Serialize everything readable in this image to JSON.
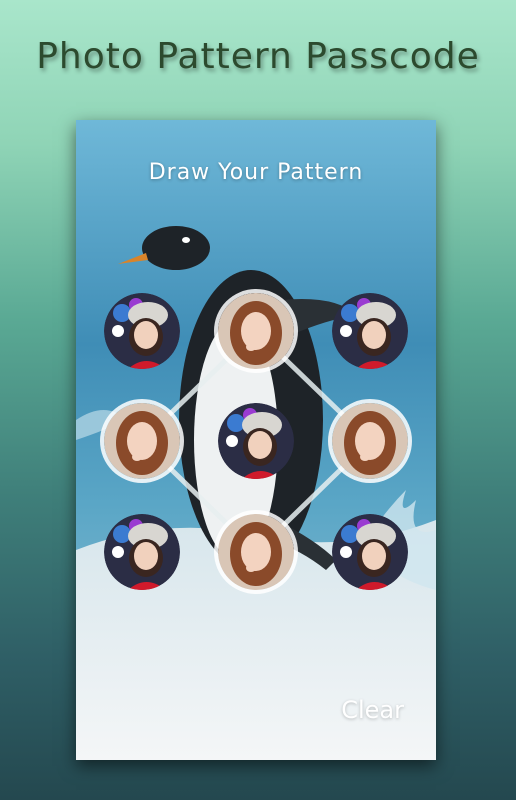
{
  "app": {
    "title": "Photo Pattern Passcode"
  },
  "lock_screen": {
    "prompt": "Draw Your Pattern",
    "clear_label": "Clear",
    "pattern_grid": {
      "rows": 3,
      "cols": 3,
      "selected_dots": [
        2,
        4,
        6,
        8
      ],
      "dots": [
        {
          "index": 1,
          "photo": "girl-with-knit-hat",
          "selected": false
        },
        {
          "index": 2,
          "photo": "girl-smiling",
          "selected": true
        },
        {
          "index": 3,
          "photo": "girl-with-knit-hat",
          "selected": false
        },
        {
          "index": 4,
          "photo": "girl-smiling",
          "selected": true
        },
        {
          "index": 5,
          "photo": "girl-with-knit-hat",
          "selected": false
        },
        {
          "index": 6,
          "photo": "girl-smiling",
          "selected": true
        },
        {
          "index": 7,
          "photo": "girl-with-knit-hat",
          "selected": false
        },
        {
          "index": 8,
          "photo": "girl-smiling",
          "selected": true
        },
        {
          "index": 9,
          "photo": "girl-with-knit-hat",
          "selected": false
        }
      ]
    },
    "background_photo": "penguin-on-ice"
  },
  "colors": {
    "title_text": "#2c4a2e",
    "prompt_text": "#ffffff",
    "pattern_line": "#e6eef0"
  }
}
